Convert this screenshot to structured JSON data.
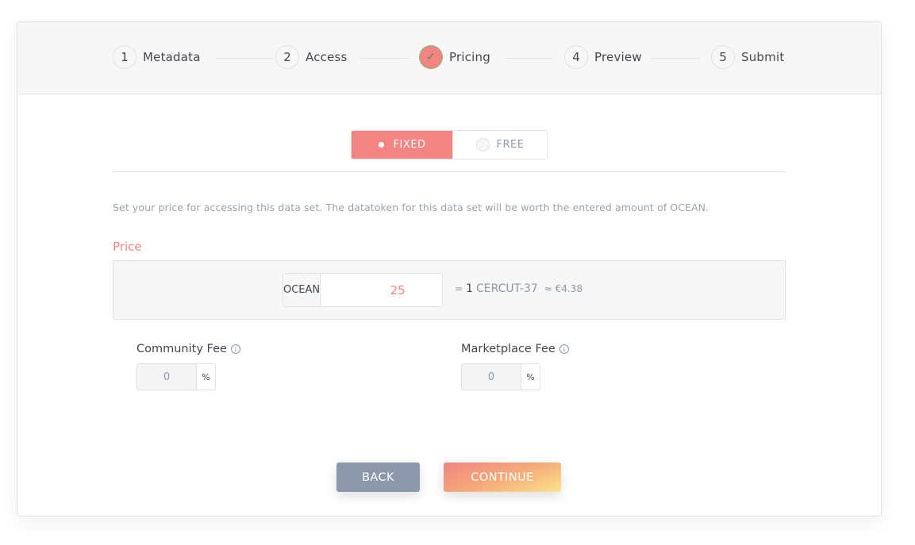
{
  "steps": [
    {
      "number": "1",
      "label": "Metadata",
      "state": "pending"
    },
    {
      "number": "2",
      "label": "Access",
      "state": "pending"
    },
    {
      "number": "✓",
      "label": "Pricing",
      "state": "current-complete"
    },
    {
      "number": "4",
      "label": "Preview",
      "state": "pending"
    },
    {
      "number": "5",
      "label": "Submit",
      "state": "pending"
    }
  ],
  "pricing_type": {
    "options": [
      {
        "label": "FIXED",
        "selected": true
      },
      {
        "label": "FREE",
        "selected": false
      }
    ]
  },
  "help_text": "Set your price for accessing this data set. The datatoken for this data set will be worth the entered amount of OCEAN.",
  "price": {
    "label": "Price",
    "currency": "OCEAN",
    "value": "25",
    "conversion_prefix": "=",
    "conversion_amount": "1",
    "datatoken": "CERCUT-37",
    "fiat_estimate": "≈ €4.38"
  },
  "fees": {
    "community": {
      "label": "Community Fee",
      "value": "0",
      "unit": "%",
      "info_icon": "info-icon"
    },
    "marketplace": {
      "label": "Marketplace Fee",
      "value": "0",
      "unit": "%",
      "info_icon": "info-icon"
    }
  },
  "actions": {
    "back_label": "BACK",
    "continue_label": "CONTINUE"
  },
  "colors": {
    "accent": "#f28482",
    "muted": "#8b98a9",
    "text": "#41474e"
  }
}
